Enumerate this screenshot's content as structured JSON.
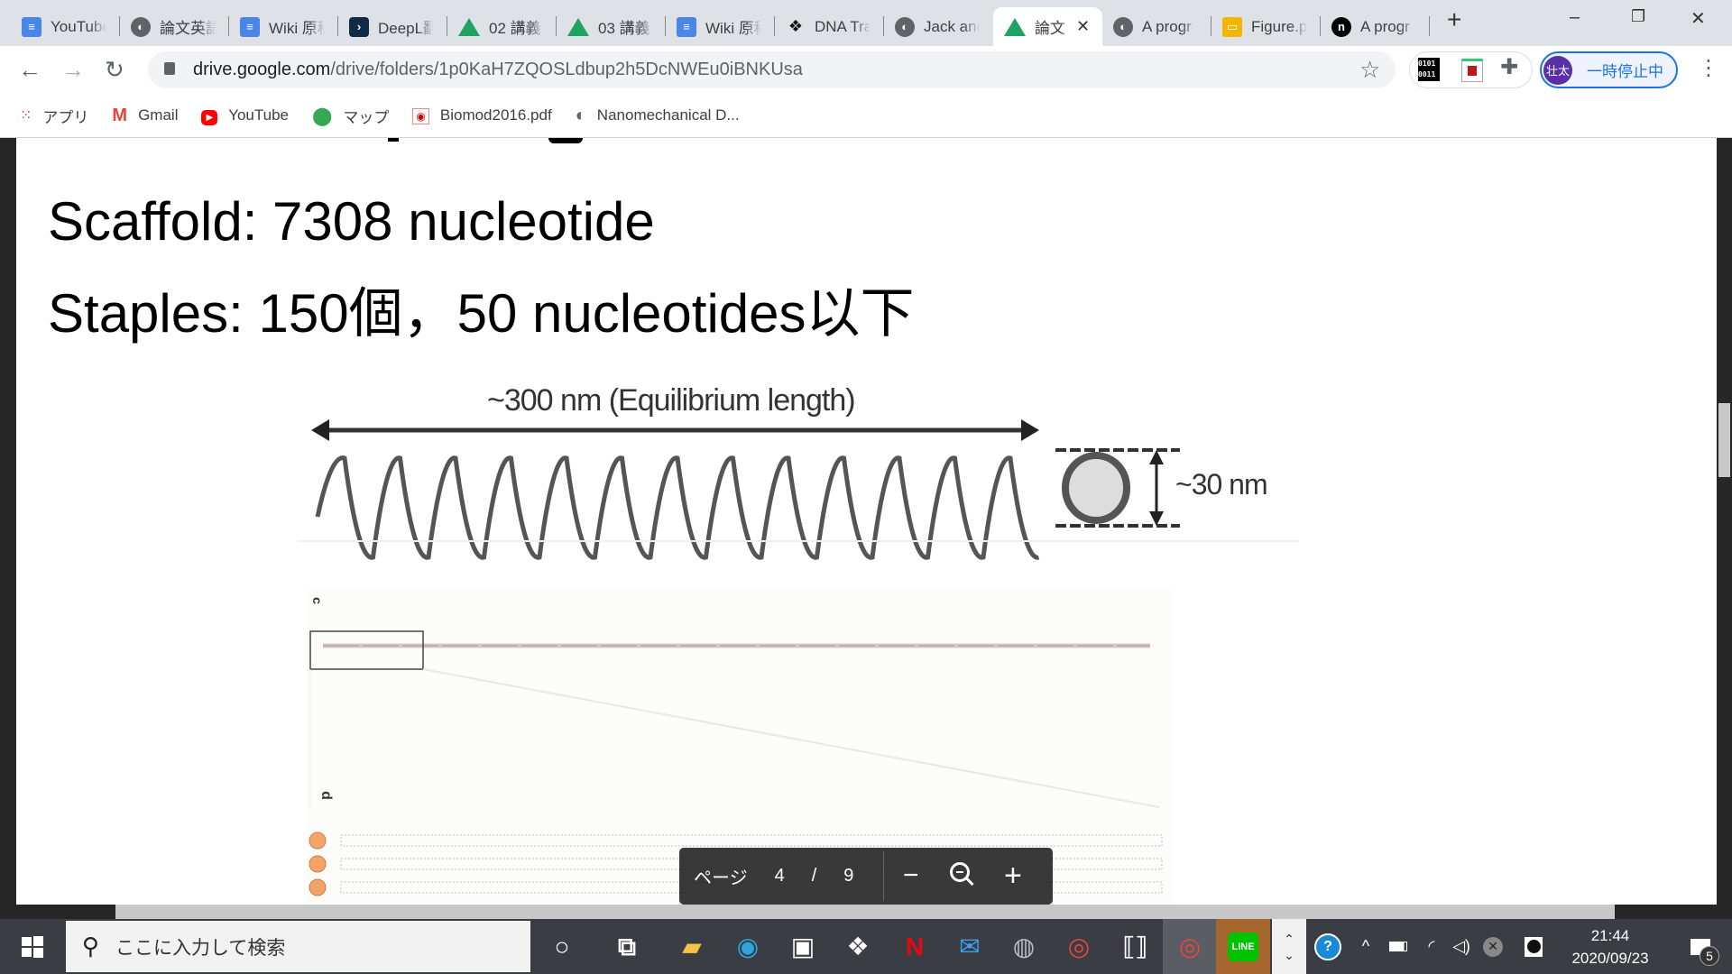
{
  "browser": {
    "tabs": [
      {
        "label": "YouTube",
        "icon": "docs-icon"
      },
      {
        "label": "論文英語",
        "icon": "globe-icon"
      },
      {
        "label": "Wiki 原稿",
        "icon": "docs-icon"
      },
      {
        "label": "DeepL翻訳",
        "icon": "deepl-icon"
      },
      {
        "label": "02 講義",
        "icon": "drive-icon"
      },
      {
        "label": "03 講義",
        "icon": "drive-icon"
      },
      {
        "label": "Wiki 原稿",
        "icon": "docs-icon"
      },
      {
        "label": "DNA Tra",
        "icon": "dna-icon"
      },
      {
        "label": "Jack and",
        "icon": "globe-icon"
      },
      {
        "label": "論文",
        "icon": "drive-icon",
        "active": true
      },
      {
        "label": "A progr",
        "icon": "globe-icon"
      },
      {
        "label": "Figure.p",
        "icon": "slides-icon"
      },
      {
        "label": "A progr",
        "icon": "n-icon"
      }
    ],
    "url_host": "drive.google.com",
    "url_path": "/drive/folders/1p0KaH7ZQOSLdbup2h5DcNWEu0iBNKUsa",
    "profile_initials": "壮太",
    "profile_status": "一時停止中",
    "ext_binary": "0101\n0011",
    "bookmarks": [
      {
        "label": "アプリ",
        "icon": "apps-grid-icon"
      },
      {
        "label": "Gmail",
        "icon": "gmail-icon"
      },
      {
        "label": "YouTube",
        "icon": "youtube-icon"
      },
      {
        "label": "マップ",
        "icon": "maps-icon"
      },
      {
        "label": "Biomod2016.pdf",
        "icon": "pdf-icon"
      },
      {
        "label": "Nanomechanical D...",
        "icon": "globe-icon"
      }
    ]
  },
  "slide": {
    "line1": "Scaffold: 7308 nucleotide",
    "line2": "Staples: 150個，50 nucleotides以下",
    "figure_length_label": "~300 nm (Equilibrium length)",
    "figure_diameter_label": "~30 nm",
    "panel_label_c": "c",
    "panel_label_d": "d"
  },
  "pdf_toolbar": {
    "page_label": "ページ",
    "current_page": "4",
    "separator": "/",
    "total_pages": "9"
  },
  "taskbar": {
    "search_placeholder": "ここに入力して検索",
    "time": "21:44",
    "date": "2020/09/23",
    "notification_count": "5"
  },
  "colors": {
    "tabbar": "#dee1e6",
    "taskbar": "#3a3d44",
    "profile": "#5a2ea6",
    "accent": "#1a73e8"
  }
}
